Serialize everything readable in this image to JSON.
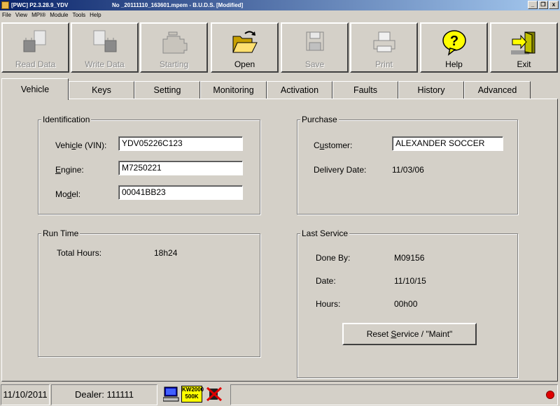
{
  "window": {
    "title_left": "[PWC] P2.3.28.9_YDV",
    "title_right": "No _20111110_163601.mpem - B.U.D.S. [Modified]",
    "btn_minimize": "_",
    "btn_restore": "❐",
    "btn_close": "x"
  },
  "menu": [
    "File",
    "View",
    "MPI®",
    "Module",
    "Tools",
    "Help"
  ],
  "toolbar": {
    "read_data": "Read Data",
    "write_data": "Write Data",
    "starting": "Starting",
    "open": "Open",
    "save": "Save",
    "print": "Print",
    "help": "Help",
    "exit": "Exit"
  },
  "tabs": [
    "Vehicle",
    "Keys",
    "Setting",
    "Monitoring",
    "Activation",
    "Faults",
    "History",
    "Advanced"
  ],
  "identification": {
    "title": "Identification",
    "vin_label_pre": "Vehi",
    "vin_label_u": "c",
    "vin_label_post": "le (VIN):",
    "vin_value": "YDV05226C123",
    "engine_label_u": "E",
    "engine_label_post": "ngine:",
    "engine_value": "M7250221",
    "model_label_pre": "Mo",
    "model_label_u": "d",
    "model_label_post": "el:",
    "model_value": "00041BB23"
  },
  "purchase": {
    "title": "Purchase",
    "customer_label_pre": "C",
    "customer_label_u": "u",
    "customer_label_post": "stomer:",
    "customer_value": "ALEXANDER SOCCER",
    "delivery_label": "Delivery Date:",
    "delivery_value": "11/03/06"
  },
  "runtime": {
    "title": "Run Time",
    "hours_label": "Total Hours:",
    "hours_value": "18h24"
  },
  "last_service": {
    "title": "Last Service",
    "doneby_label": "Done By:",
    "doneby_value": "M09156",
    "date_label": "Date:",
    "date_value": "11/10/15",
    "hours_label": "Hours:",
    "hours_value": "00h00",
    "reset_pre": "Reset ",
    "reset_u": "S",
    "reset_post": "ervice / \"Maint\""
  },
  "status": {
    "date": "11/10/2011",
    "dealer": "Dealer: 111111",
    "badge_line1": "KW2000",
    "badge_line2": "500K"
  },
  "colors": {
    "titlebar_start": "#0a246a",
    "titlebar_end": "#a6caf0",
    "face": "#d4d0c8",
    "status_red": "#e00000",
    "icon_yellow": "#ffff00"
  }
}
